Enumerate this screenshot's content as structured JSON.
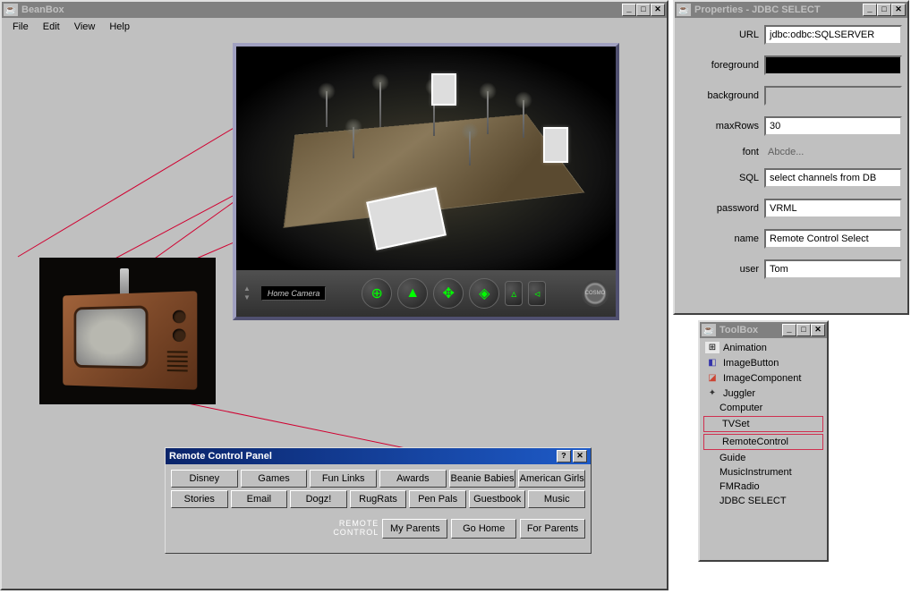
{
  "beanbox": {
    "title": "BeanBox",
    "icon_glyph": "☕",
    "menu": [
      "File",
      "Edit",
      "View",
      "Help"
    ],
    "viewer": {
      "home_camera": "Home Camera",
      "cosmo": "COSMO"
    }
  },
  "remote": {
    "title": "Remote Control Panel",
    "row1": [
      "Disney",
      "Games",
      "Fun Links",
      "Awards",
      "Beanie Babies",
      "American Girls"
    ],
    "row2": [
      "Stories",
      "Email",
      "Dogz!",
      "RugRats",
      "Pen Pals",
      "Guestbook",
      "Music"
    ],
    "label": "Remote Control",
    "bottom": [
      "My Parents",
      "Go Home",
      "For Parents"
    ]
  },
  "props": {
    "title": "Properties - JDBC SELECT",
    "rows": [
      {
        "label": "URL",
        "value": "jdbc:odbc:SQLSERVER",
        "type": "text"
      },
      {
        "label": "foreground",
        "type": "black"
      },
      {
        "label": "background",
        "type": "grey"
      },
      {
        "label": "maxRows",
        "value": "30",
        "type": "text"
      },
      {
        "label": "font",
        "value": "Abcde...",
        "type": "static"
      },
      {
        "label": "SQL",
        "value": "select channels from DB",
        "type": "text"
      },
      {
        "label": "password",
        "value": "VRML",
        "type": "text"
      },
      {
        "label": "name",
        "value": "Remote Control Select",
        "type": "text"
      },
      {
        "label": "user",
        "value": "Tom",
        "type": "text"
      }
    ]
  },
  "toolbox": {
    "title": "ToolBox",
    "items": [
      {
        "label": "Animation",
        "icon": "anim"
      },
      {
        "label": "ImageButton",
        "icon": "imgbtn"
      },
      {
        "label": "ImageComponent",
        "icon": "imgcmp"
      },
      {
        "label": "Juggler",
        "icon": "jug"
      },
      {
        "label": "Computer"
      },
      {
        "label": "TVSet",
        "boxed": true
      },
      {
        "label": "RemoteControl",
        "boxed": true
      },
      {
        "label": "Guide"
      },
      {
        "label": "MusicInstrument"
      },
      {
        "label": "FMRadio"
      },
      {
        "label": "JDBC SELECT"
      }
    ]
  }
}
